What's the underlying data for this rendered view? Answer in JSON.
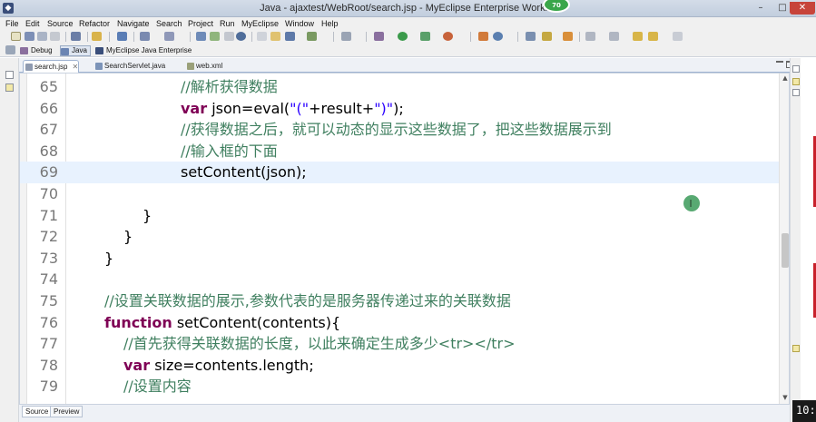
{
  "window": {
    "title": "Java - ajaxtest/WebRoot/search.jsp - MyEclipse Enterprise Workbe",
    "badge": "70",
    "app_icon": "myeclipse-logo-icon",
    "controls": {
      "minimize": "–",
      "maximize": "□",
      "close": "✕"
    }
  },
  "menu": [
    "File",
    "Edit",
    "Source",
    "Refactor",
    "Navigate",
    "Search",
    "Project",
    "Run",
    "MyEclipse",
    "Window",
    "Help"
  ],
  "perspectives": {
    "debug_label": "Debug",
    "java_label": "Java",
    "myeclipse_label": "MyEclipse Java Enterprise"
  },
  "editor_tabs": [
    {
      "label": "search.jsp",
      "active": true,
      "close": "✕"
    },
    {
      "label": "SearchServlet.java",
      "active": false
    },
    {
      "label": "web.xml",
      "active": false
    }
  ],
  "code_lines": [
    {
      "num": "65",
      "text": "//解析获得数据"
    },
    {
      "num": "66",
      "kw": "var",
      "pre": " json=eval(",
      "s1": "\"(\"",
      "mid": "+result+",
      "s2": "\")\"",
      "post": ");"
    },
    {
      "num": "67",
      "text": "//获得数据之后，就可以动态的显示这些数据了，把这些数据展示到"
    },
    {
      "num": "68",
      "text": "//输入框的下面"
    },
    {
      "num": "69",
      "text": "setContent(json);"
    },
    {
      "num": "70",
      "text": ""
    },
    {
      "num": "71",
      "text": "}"
    },
    {
      "num": "72",
      "text": "}"
    },
    {
      "num": "73",
      "text": "}"
    },
    {
      "num": "74",
      "text": ""
    },
    {
      "num": "75",
      "text": "//设置关联数据的展示,参数代表的是服务器传递过来的关联数据"
    },
    {
      "num": "76",
      "kw": "function",
      "text": " setContent(contents){"
    },
    {
      "num": "77",
      "text": "//首先获得关联数据的长度，以此来确定生成多少<tr></tr>"
    },
    {
      "num": "78",
      "kw": "var",
      "text": " size=contents.length;"
    },
    {
      "num": "79",
      "text": "//设置内容"
    }
  ],
  "bottom_tabs": {
    "source": "Source",
    "preview": "Preview"
  },
  "clock": "10:",
  "colors": {
    "comment": "#3f7f5f",
    "keyword": "#7f0055",
    "string": "#2a00ff",
    "current_line": "#e8f2fe"
  }
}
